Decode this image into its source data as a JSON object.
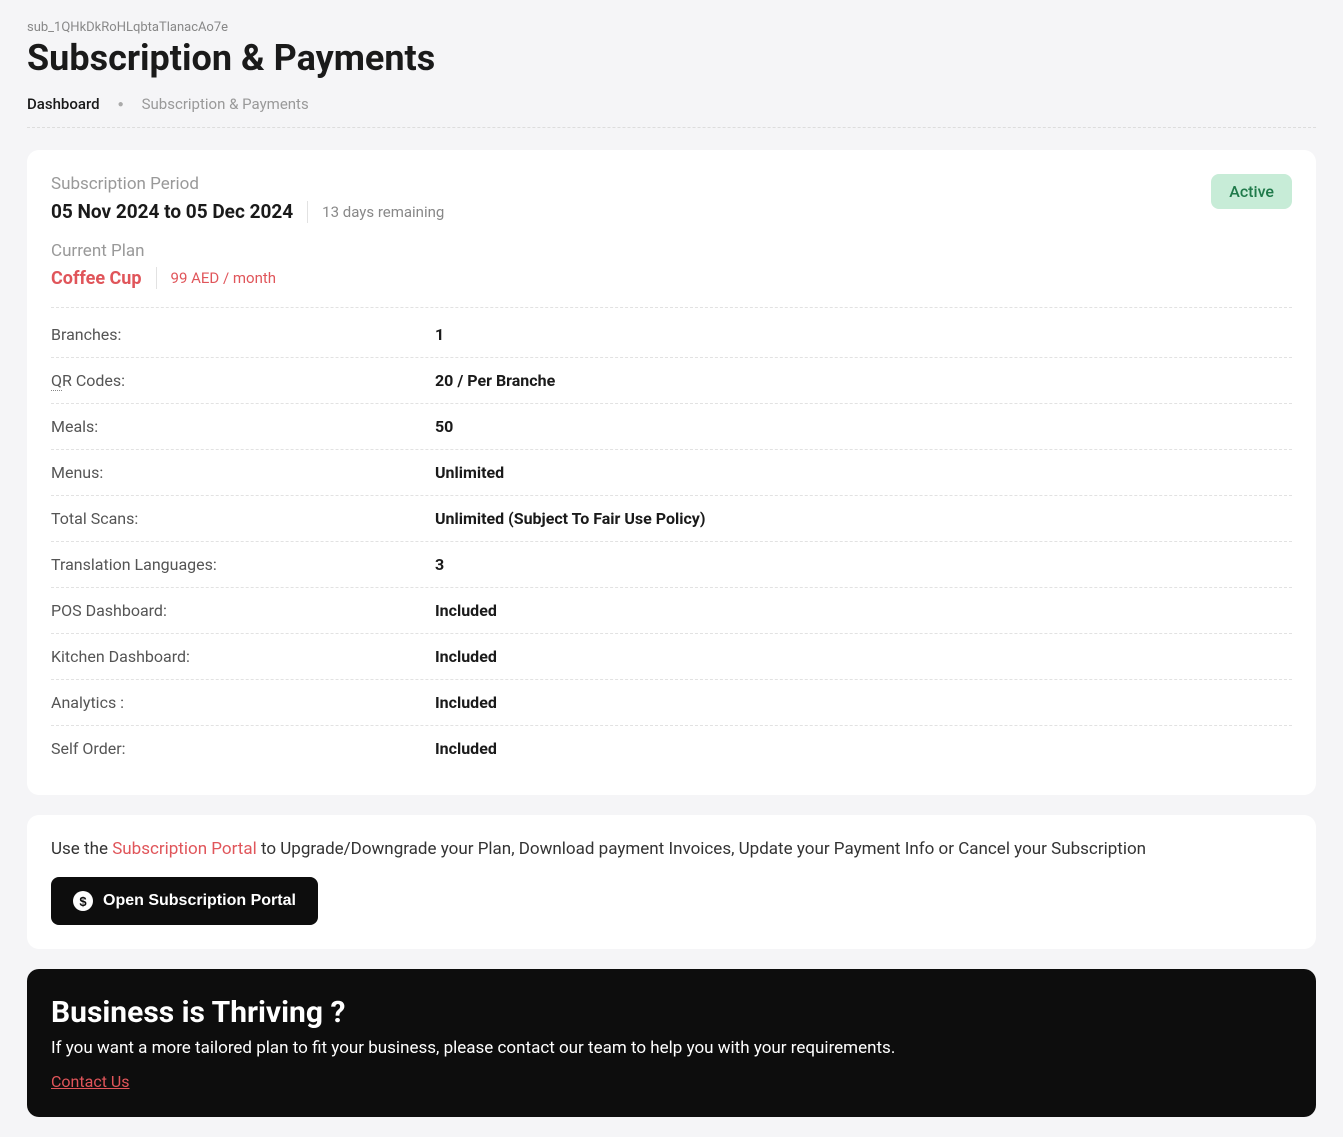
{
  "header": {
    "sub_id": "sub_1QHkDkRoHLqbtaTlanacAo7e",
    "title": "Subscription & Payments"
  },
  "breadcrumb": {
    "dashboard": "Dashboard",
    "sep": "●",
    "current": "Subscription & Payments"
  },
  "status_badge": "Active",
  "subscription_period": {
    "label": "Subscription Period",
    "value": "05 Nov 2024 to 05 Dec 2024",
    "remaining": "13 days remaining"
  },
  "current_plan": {
    "label": "Current Plan",
    "name": "Coffee Cup",
    "price": "99 AED / month"
  },
  "features": [
    {
      "label": "Branches:",
      "value": "1"
    },
    {
      "label": "QR Codes:",
      "value": "20 / Per Branche",
      "qr": true
    },
    {
      "label": "Meals:",
      "value": "50"
    },
    {
      "label": "Menus:",
      "value": "Unlimited"
    },
    {
      "label": "Total Scans:",
      "value": "Unlimited (Subject To Fair Use Policy)"
    },
    {
      "label": "Translation Languages:",
      "value": "3"
    },
    {
      "label": "POS Dashboard:",
      "value": "Included"
    },
    {
      "label": "Kitchen Dashboard:",
      "value": "Included"
    },
    {
      "label": "Analytics :",
      "value": "Included"
    },
    {
      "label": "Self Order:",
      "value": "Included"
    }
  ],
  "portal": {
    "prefix": "Use the ",
    "highlight": "Subscription Portal",
    "suffix": " to Upgrade/Downgrade your Plan, Download payment Invoices, Update your Payment Info or Cancel your Subscription",
    "button": "Open Subscription Portal",
    "dollar": "$"
  },
  "thriving": {
    "title": "Business is Thriving ?",
    "text": "If you want a more tailored plan to fit your business, please contact our team to help you with your requirements.",
    "link": "Contact Us"
  }
}
